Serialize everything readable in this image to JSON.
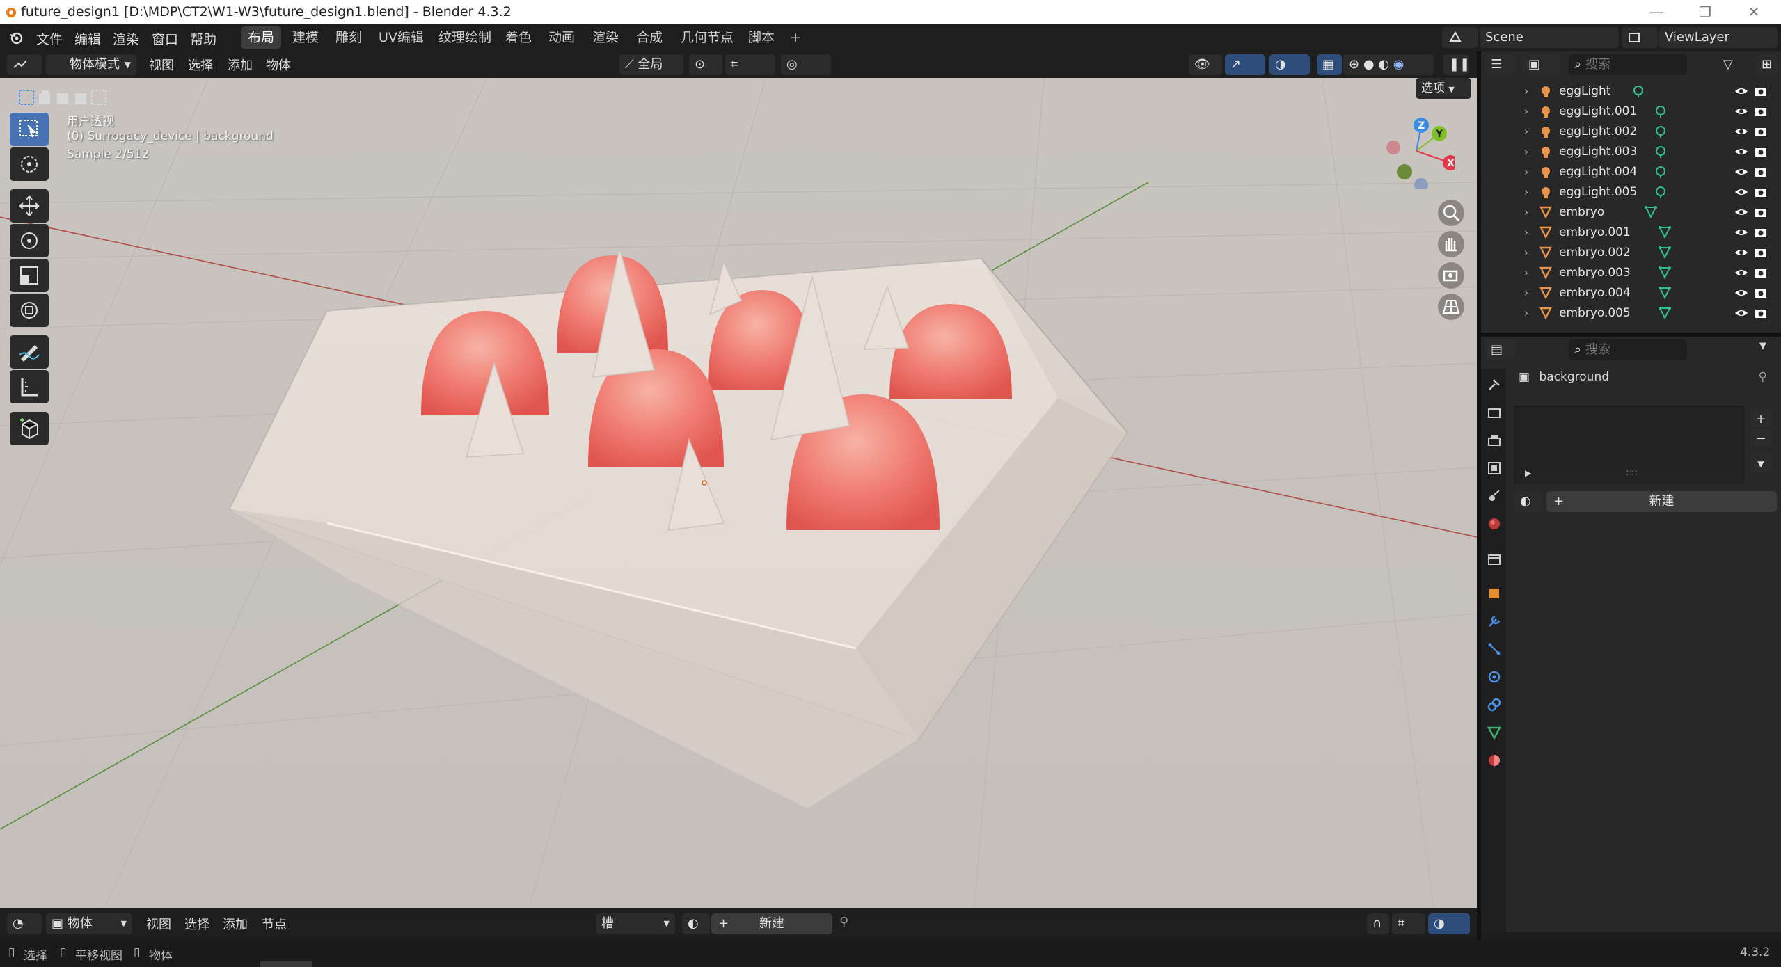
{
  "window": {
    "title": "future_design1 [D:\\MDP\\CT2\\W1-W3\\future_design1.blend] - Blender 4.3.2",
    "minimize": "—",
    "restore": "❐",
    "close": "✕"
  },
  "menu": {
    "items": [
      "文件",
      "编辑",
      "渲染",
      "窗口",
      "帮助"
    ],
    "workspaces": [
      "布局",
      "建模",
      "雕刻",
      "UV编辑",
      "纹理绘制",
      "着色",
      "动画",
      "渲染",
      "合成",
      "几何节点",
      "脚本"
    ],
    "active_workspace": "布局",
    "add_tab": "+",
    "scene": "Scene",
    "view_layer": "ViewLayer"
  },
  "viewport_header": {
    "mode": "物体模式",
    "menus": [
      "视图",
      "选择",
      "添加",
      "物体"
    ],
    "transform_orientation": "全局",
    "options": "选项"
  },
  "viewport": {
    "view_name": "用户透视",
    "collection_info": "(0) Surrogacy_device | background",
    "sample": "Sample 2/512",
    "gizmo": {
      "x": "X",
      "y": "Y",
      "z": "Z"
    },
    "colors": {
      "x_axis": "#e3374a",
      "y_axis": "#7fbf2a",
      "z_axis": "#3c8be0",
      "egg": "#f07c72",
      "device": "#e5dcd5"
    }
  },
  "outliner": {
    "search_placeholder": "搜索",
    "rows": [
      {
        "name": "eggLight",
        "type": "light"
      },
      {
        "name": "eggLight.001",
        "type": "light"
      },
      {
        "name": "eggLight.002",
        "type": "light"
      },
      {
        "name": "eggLight.003",
        "type": "light"
      },
      {
        "name": "eggLight.004",
        "type": "light"
      },
      {
        "name": "eggLight.005",
        "type": "light"
      },
      {
        "name": "embryo",
        "type": "mesh"
      },
      {
        "name": "embryo.001",
        "type": "mesh"
      },
      {
        "name": "embryo.002",
        "type": "mesh"
      },
      {
        "name": "embryo.003",
        "type": "mesh"
      },
      {
        "name": "embryo.004",
        "type": "mesh"
      },
      {
        "name": "embryo.005",
        "type": "mesh"
      }
    ]
  },
  "properties": {
    "search_placeholder": "搜索",
    "object_name": "background",
    "new_button": "新建"
  },
  "timeline": {
    "editor": "物体",
    "menus": [
      "视图",
      "选择",
      "添加",
      "节点"
    ],
    "slot": "槽",
    "new_button": "新建"
  },
  "statusbar": {
    "hints": [
      "选择",
      "平移视图",
      "物体"
    ],
    "version": "4.3.2"
  }
}
